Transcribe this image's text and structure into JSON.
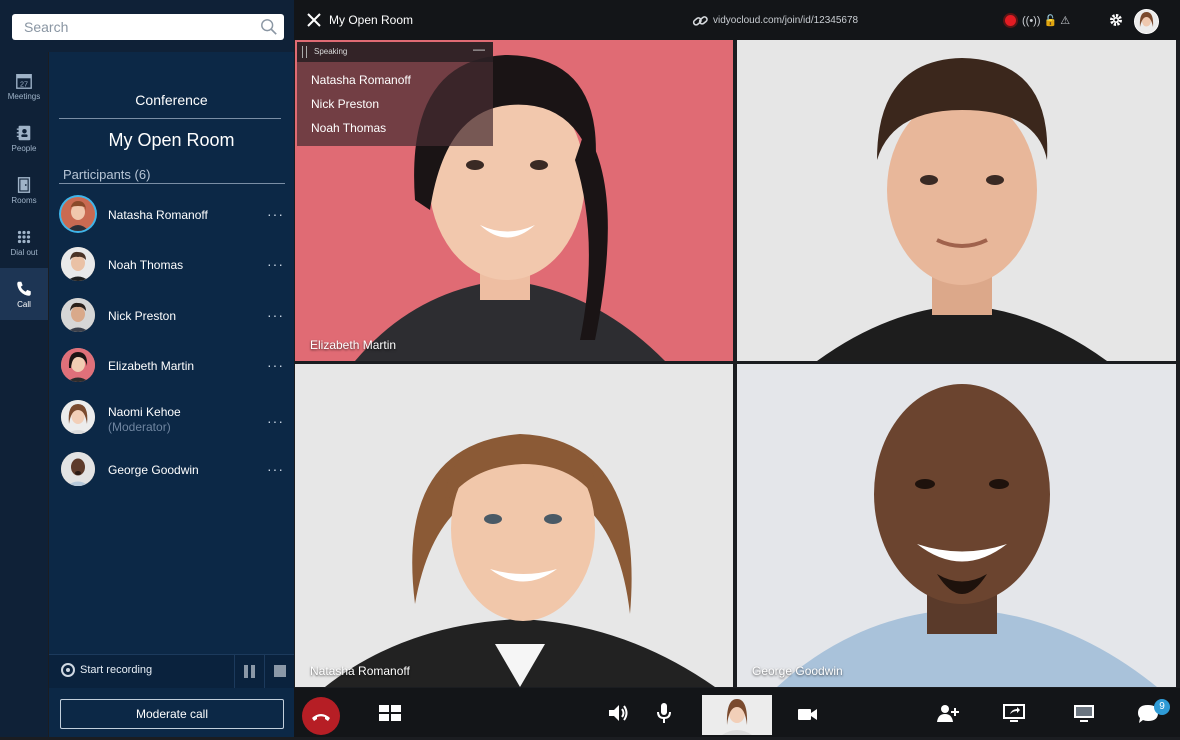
{
  "search": {
    "placeholder": "Search"
  },
  "rail": {
    "items": [
      {
        "label": "Meetings",
        "icon": "calendar-icon",
        "date": "27"
      },
      {
        "label": "People",
        "icon": "contacts-icon"
      },
      {
        "label": "Rooms",
        "icon": "door-icon"
      },
      {
        "label": "Dial out",
        "icon": "dialpad-icon"
      },
      {
        "label": "Call",
        "icon": "phone-icon",
        "active": true
      }
    ]
  },
  "panel": {
    "section_label": "Conference",
    "room_name": "My Open Room",
    "participants_heading": "Participants (6)",
    "participants": [
      {
        "name": "Natasha Romanoff",
        "sub": "",
        "more": "···"
      },
      {
        "name": "Noah Thomas",
        "sub": "",
        "more": "···"
      },
      {
        "name": "Nick Preston",
        "sub": "",
        "more": "···"
      },
      {
        "name": "Elizabeth Martin",
        "sub": "",
        "more": "···"
      },
      {
        "name": "Naomi Kehoe",
        "sub": "(Moderator)",
        "more": "···"
      },
      {
        "name": "George Goodwin",
        "sub": "",
        "more": "···"
      }
    ],
    "recording_label": "Start recording",
    "moderate_label": "Moderate call"
  },
  "topbar": {
    "room_title": "My Open Room",
    "link": "vidyocloud.com/join/id/12345678",
    "status_glyphs": "((•))  🔓  ⚠"
  },
  "speaking": {
    "title": "Speaking",
    "minimize": "—",
    "names": [
      "Natasha Romanoff",
      "Nick Preston",
      "Noah Thomas"
    ]
  },
  "tiles": [
    {
      "name": "Elizabeth Martin"
    },
    {
      "name": ""
    },
    {
      "name": "Natasha Romanoff"
    },
    {
      "name": "George Goodwin"
    }
  ],
  "bottombar": {
    "chat_badge": "9"
  },
  "colors": {
    "accent": "#3fb5ea",
    "panel": "#0c2846",
    "end_call": "#b61e25",
    "record": "#e21c23"
  }
}
